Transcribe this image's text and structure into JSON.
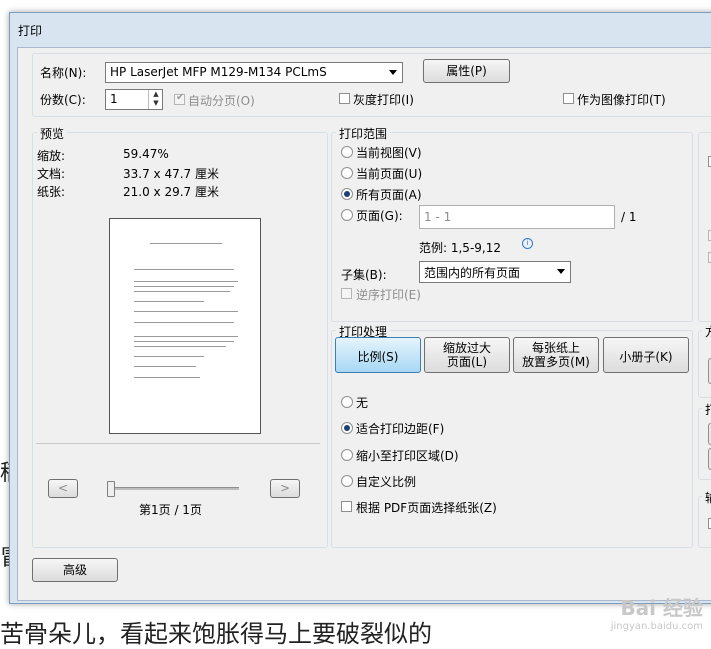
{
  "background": {
    "line1": "稿",
    "line2": "冒",
    "bottom_text": "苦骨朵儿，看起来饱胀得马上要破裂似的"
  },
  "window": {
    "title": "打印"
  },
  "printer": {
    "name_label": "名称(N):",
    "name_value": "HP LaserJet MFP M129-M134 PCLmS",
    "properties_button": "属性(P)",
    "copies_label": "份数(C):",
    "copies_value": "1",
    "collate_label": "自动分页(O)",
    "grayscale_label": "灰度打印(I)",
    "as_image_label": "作为图像打印(T)"
  },
  "preview": {
    "title": "预览",
    "zoom_label": "缩放:",
    "zoom_value": "59.47%",
    "document_label": "文档:",
    "document_value": "33.7 x 47.7 厘米",
    "paper_label": "纸张:",
    "paper_value": "21.0 x 29.7 厘米",
    "prev_button": "<",
    "next_button": ">",
    "page_indicator": "第1页 / 1页"
  },
  "print_range": {
    "title": "打印范围",
    "options": [
      "当前视图(V)",
      "当前页面(U)",
      "所有页面(A)",
      "页面(G):"
    ],
    "selected": "所有页面(A)",
    "pages_placeholder": "1 - 1",
    "pages_total": "/ 1",
    "example": "范例: 1,5-9,12",
    "subset_label": "子集(B):",
    "subset_value": "范围内的所有页面",
    "reverse_label": "逆序打印(E)"
  },
  "print_handling": {
    "title": "打印处理",
    "tabs": [
      "比例(S)",
      "缩放过大页面(L)",
      "每张纸上放置多页(M)",
      "小册子(K)"
    ],
    "tab_lines": [
      [
        "比例(S)"
      ],
      [
        "缩放过大",
        "页面(L)"
      ],
      [
        "每张纸上",
        "放置多页(M)"
      ],
      [
        "小册子(K)"
      ]
    ],
    "active_tab": "比例(S)",
    "scale_options": [
      "无",
      "适合打印边距(F)",
      "缩小至打印区域(D)",
      "自定义比例"
    ],
    "selected_scale": "适合打印边距(F)",
    "paper_by_pdf_label": "根据 PDF页面选择纸张(Z)"
  },
  "advanced_button": "高级",
  "right_partial": {
    "g2": "方",
    "g3": "打",
    "g4": "输"
  },
  "watermark": {
    "brand": "Bai 经验",
    "url": "jingyan.baidu.com"
  },
  "colors": {
    "accent": "#3c7fb1",
    "window_frame": "#d9e4f1",
    "dialog_bg": "#f0f0f0"
  }
}
